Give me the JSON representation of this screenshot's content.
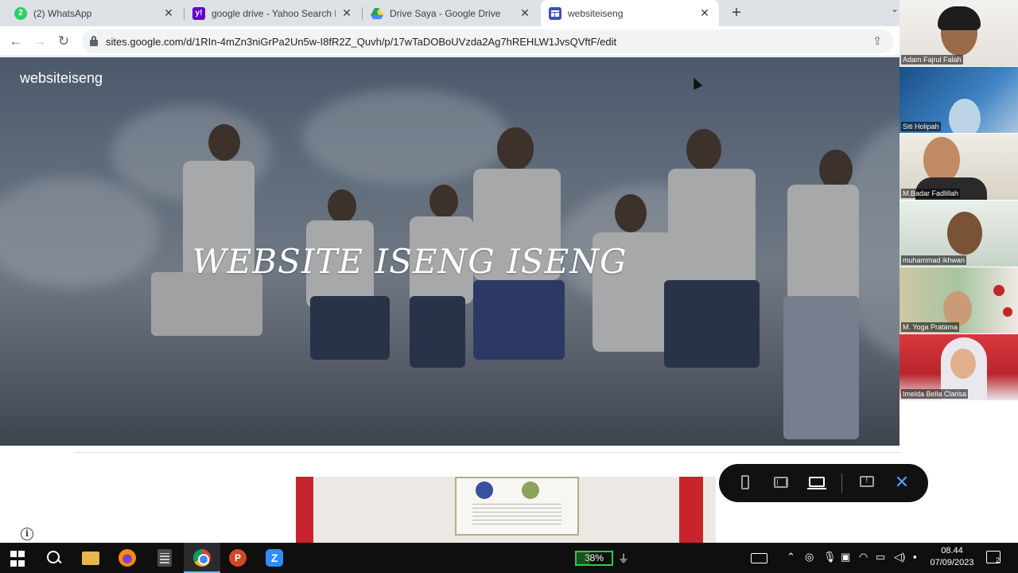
{
  "browser": {
    "tabs": [
      {
        "title": "(2) WhatsApp",
        "icon": "whatsapp-icon",
        "icon_text": "2",
        "color": "#25d366"
      },
      {
        "title": "google drive - Yahoo Search Res",
        "icon": "yahoo-icon",
        "icon_text": "y!",
        "color": "#6001d2"
      },
      {
        "title": "Drive Saya - Google Drive",
        "icon": "google-drive-icon",
        "icon_text": "",
        "color": "#1fa463"
      },
      {
        "title": "websiteiseng",
        "icon": "google-sites-icon",
        "icon_text": "",
        "color": "#3f51b5"
      }
    ],
    "tab_close_glyph": "✕",
    "new_tab_glyph": "+",
    "url": "sites.google.com/d/1RIn-4mZn3niGrPa2Un5w-I8fR2Z_Quvh/p/17wTaDOBoUVzda2Ag7hREHLW1JvsQVftF/edit"
  },
  "site": {
    "name": "websiteiseng",
    "hero_title": "WEBSITE ISENG ISENG"
  },
  "participants": [
    {
      "name": "Adam Fajrul Falah"
    },
    {
      "name": "Siti Holipah"
    },
    {
      "name": "M.Badar Fadlillah"
    },
    {
      "name": "muhammad ikhwan"
    },
    {
      "name": "M. Yoga Pratama"
    },
    {
      "name": "Imelda Bella Clarisa"
    }
  ],
  "taskbar": {
    "battery_percent": "38%",
    "battery_level": 0.38,
    "ppt_label": "P",
    "zoom_label": "Z",
    "time": "08.44",
    "date": "07/09/2023",
    "notification_count": "2"
  },
  "colors": {
    "accent": "#4ea1ff",
    "battery": "#2ecc40"
  }
}
